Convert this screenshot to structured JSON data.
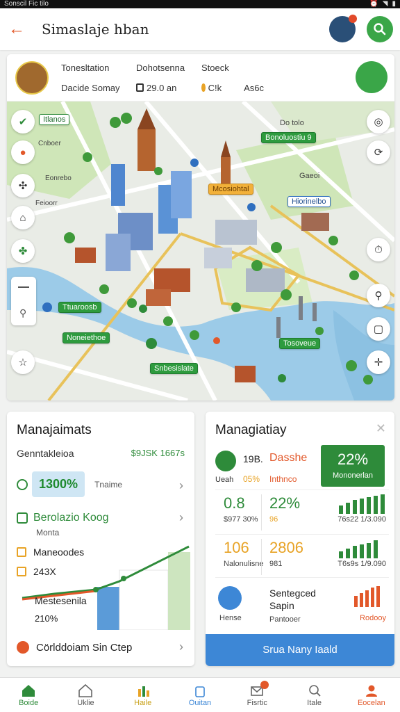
{
  "statusbar": {
    "left_text": "Sonscil  Fic  tilo"
  },
  "appbar": {
    "title": "Simaslaje hban"
  },
  "map_header": {
    "col1_top": "Tonesltation",
    "col2_top": "Dohotsenna",
    "col3_top": "Stoeck",
    "col1_bottom": "Dacide Somay",
    "col2_bottom": "29.0 an",
    "col3_bottom": "C!k",
    "col4_bottom": "As6c"
  },
  "map_labels": {
    "l1": "Itlanos",
    "l2": "Do tolo",
    "l3": "Bonoluostiu 9",
    "l4": "Gaeoi",
    "l5": "Mcosiohtal",
    "l6": "Hiorinelbo",
    "l7": "Cnboer",
    "l8": "Eonrebo",
    "l9": "Feioorr",
    "l10": "Ttuaroosb",
    "l11": "Noneiethoe",
    "l12": "Snbesislate",
    "l13": "Tosoveue"
  },
  "left_card": {
    "title": "Manajaimats",
    "row1_label": "Genntakleioa",
    "row1_value": "$9JSK 1667s",
    "stat_value": "1300%",
    "stat_text": "Tnaime",
    "green_title": "Berolazio Koog",
    "green_sub": "Monta",
    "item1": "Maneoodes",
    "item2": "243X",
    "chart_label1": "Mestesenila",
    "chart_label2": "210%",
    "bottom_label": "Cörlddoiam Sin Ctep"
  },
  "right_card": {
    "title": "Managiatiay",
    "top_t1": "19B.",
    "top_t2": "Dasshe",
    "top_s1": "Ueah",
    "top_s2": "05%",
    "top_s3": "Inthnco",
    "box_value": "22%",
    "box_label": "Mononerlan",
    "row1_v1": "0.8",
    "row1_l1": "$977 30%",
    "row1_v2": "22%",
    "row1_l2": "96",
    "row1_l3": "76s22 1/3.090",
    "row2_v1": "106",
    "row2_l1": "Nalonulisne",
    "row2_v2": "2806",
    "row2_l2": "981",
    "row2_l3": "T6s9s 1/9.090",
    "row3_t1": "Sentegced",
    "row3_t2": "Sapin",
    "row3_l1": "Hense",
    "row3_l2": "Pantooer",
    "row3_l3": "Rodooy",
    "button": "Srua Nany Iaald"
  },
  "bottom_nav": [
    {
      "label": "Boide",
      "icon": "home-icon"
    },
    {
      "label": "Uklie",
      "icon": "house-outline-icon"
    },
    {
      "label": "Haile",
      "icon": "stats-icon"
    },
    {
      "label": "Ouitan",
      "icon": "bag-icon"
    },
    {
      "label": "Fisrtic",
      "icon": "mail-icon"
    },
    {
      "label": "Itale",
      "icon": "search-person-icon"
    },
    {
      "label": "Eocelan",
      "icon": "profile-icon"
    }
  ],
  "colors": {
    "accent_green": "#2e8b3a",
    "accent_orange": "#e2582a",
    "accent_blue": "#3d87d6"
  }
}
